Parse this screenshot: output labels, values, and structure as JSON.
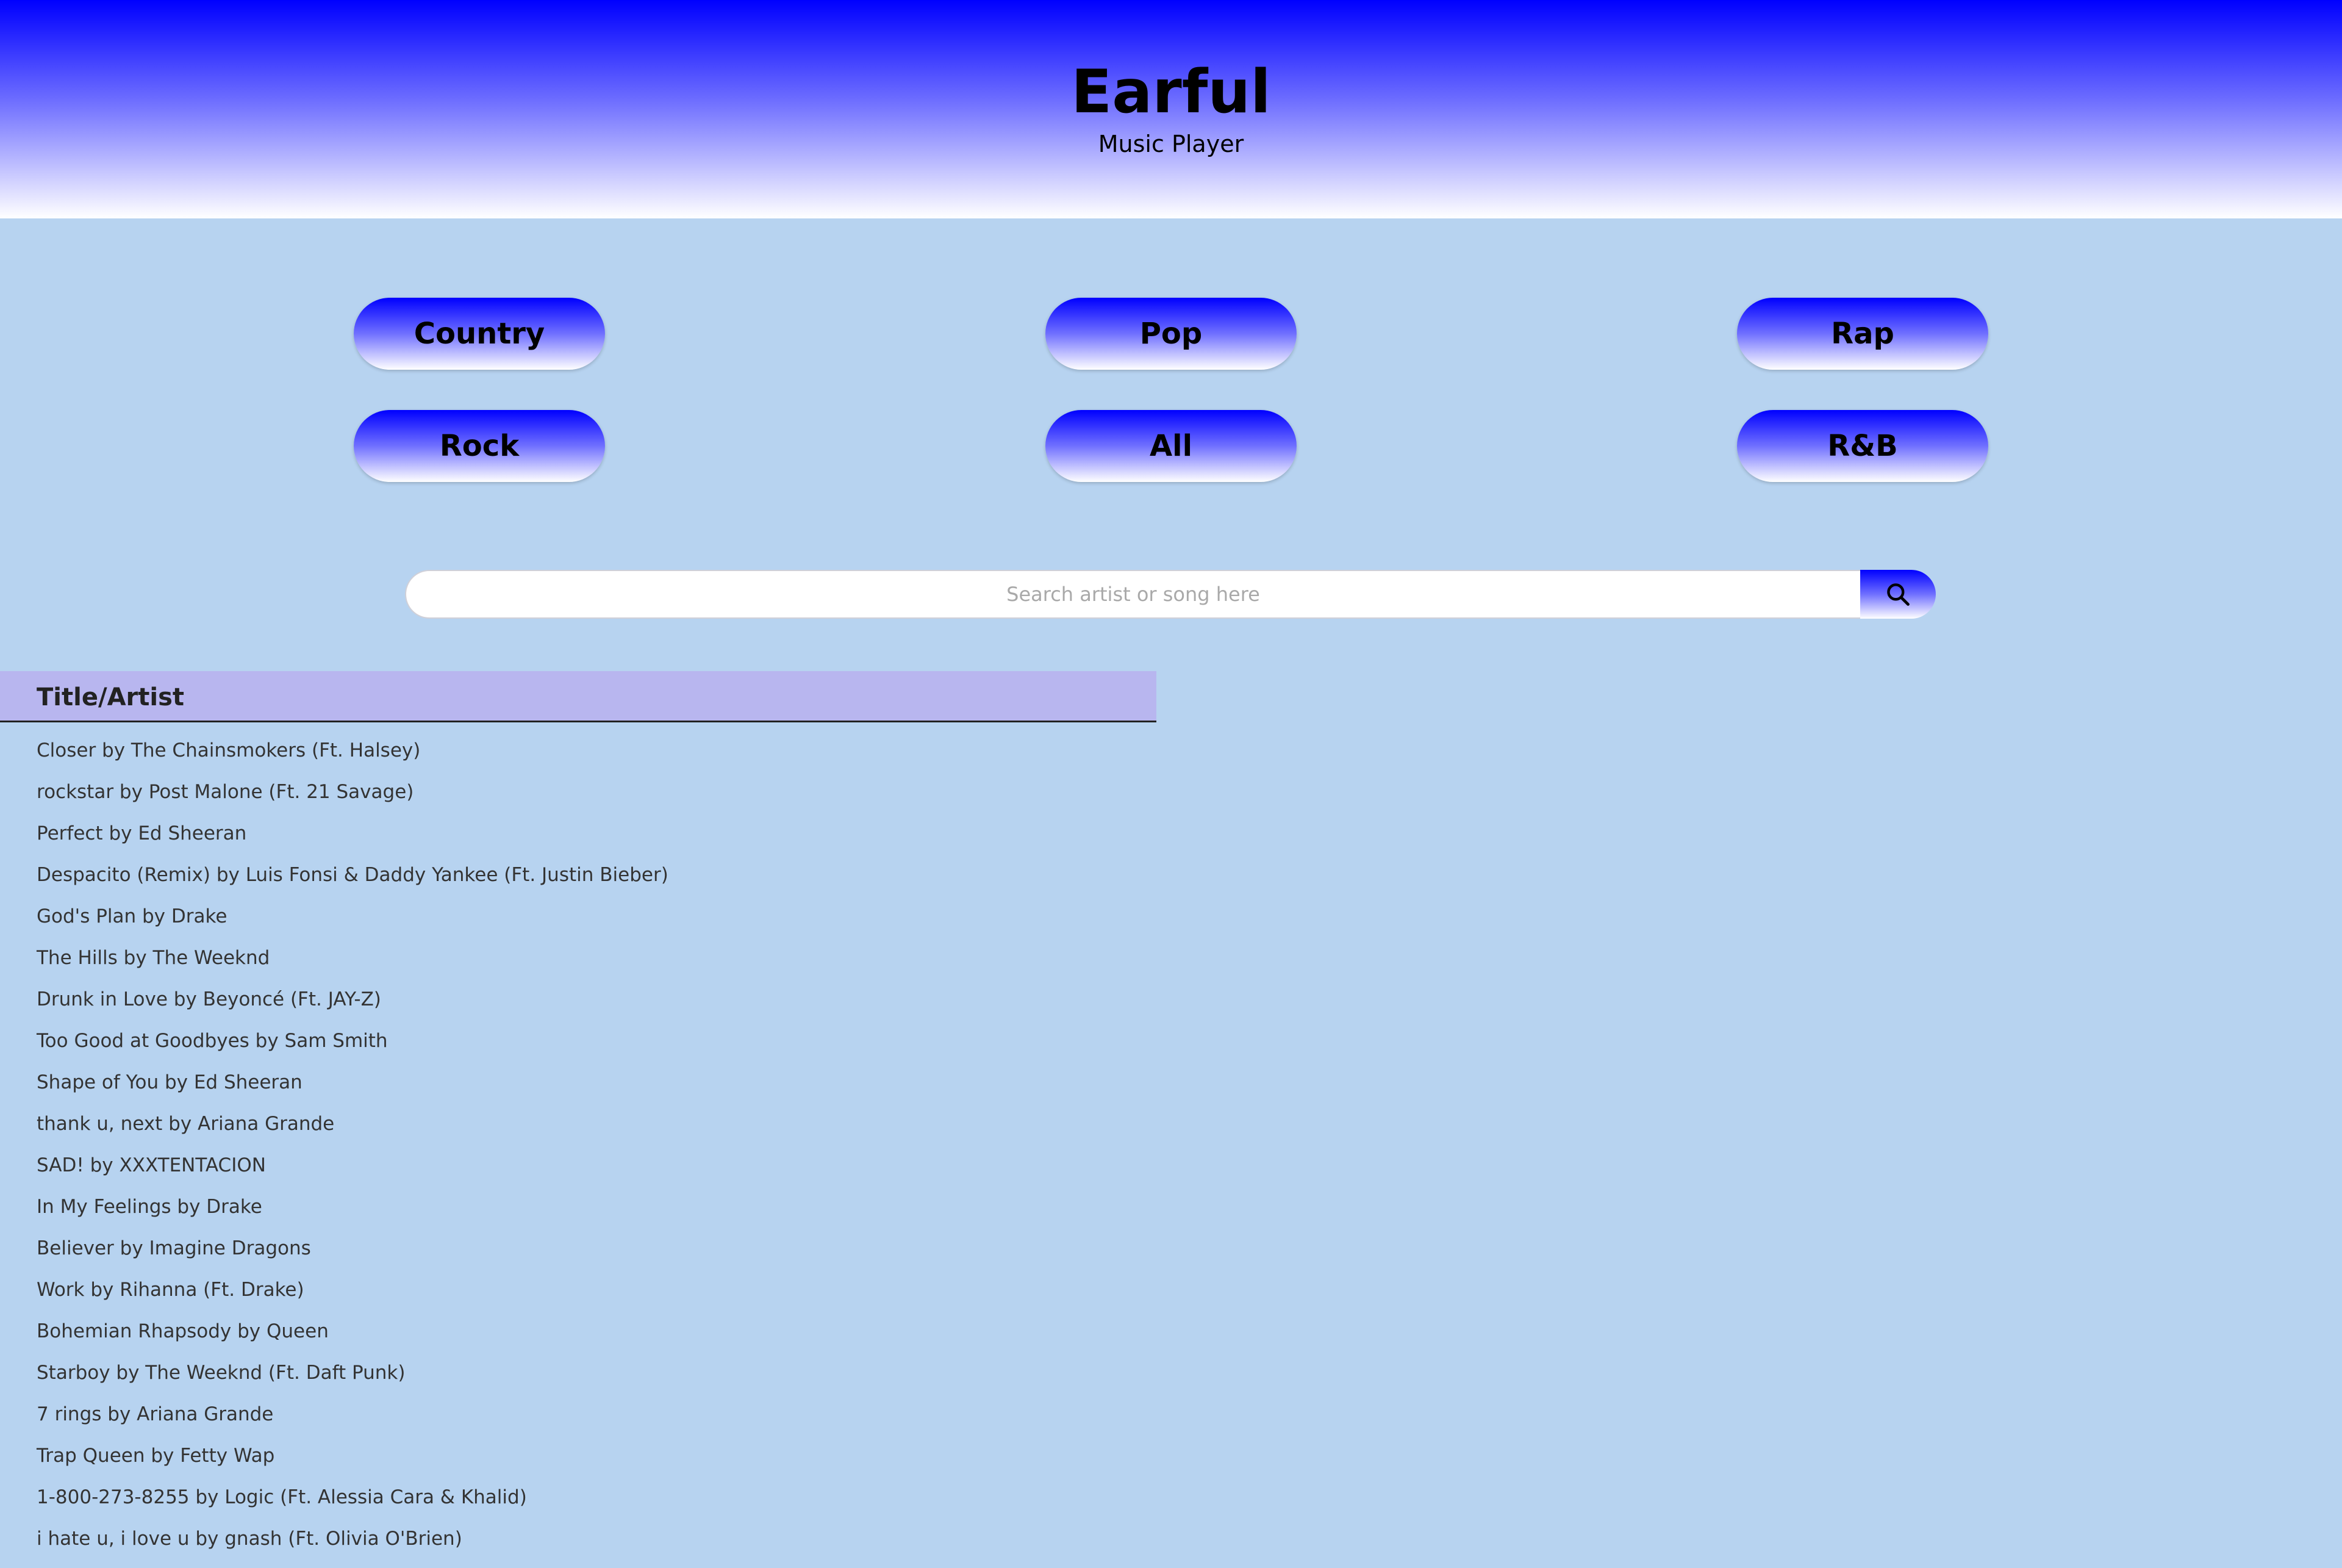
{
  "header": {
    "title": "Earful",
    "subtitle": "Music Player"
  },
  "genres": {
    "country": "Country",
    "pop": "Pop",
    "rap": "Rap",
    "rock": "Rock",
    "all": "All",
    "rnb": "R&B"
  },
  "search": {
    "placeholder": "Search artist or song here",
    "value": "",
    "icon": "search-icon"
  },
  "table": {
    "header": "Title/Artist",
    "songs": [
      "Closer by The Chainsmokers (Ft. Halsey)",
      "rockstar by Post Malone (Ft. 21 Savage)",
      "Perfect by Ed Sheeran",
      "Despacito (Remix) by Luis Fonsi & Daddy Yankee (Ft. Justin Bieber)",
      "God's Plan by Drake",
      "The Hills by The Weeknd",
      "Drunk in Love by Beyoncé (Ft. JAY-Z)",
      "Too Good at Goodbyes by Sam Smith",
      "Shape of You by Ed Sheeran",
      "thank u, next by Ariana Grande",
      "SAD! by XXXTENTACION",
      "In My Feelings by Drake",
      "Believer by Imagine Dragons",
      "Work by Rihanna (Ft. Drake)",
      "Bohemian Rhapsody by Queen",
      "Starboy by The Weeknd (Ft. Daft Punk)",
      "7 rings by Ariana Grande",
      "Trap Queen by Fetty Wap",
      "1-800-273-8255 by Logic (Ft. Alessia Cara & Khalid)",
      "i hate u, i love u by gnash (Ft. Olivia O'Brien)"
    ]
  },
  "colors": {
    "page_background": "#b7d3f0",
    "accent_blue": "#0000ff",
    "table_header": "#b8b6ef"
  }
}
